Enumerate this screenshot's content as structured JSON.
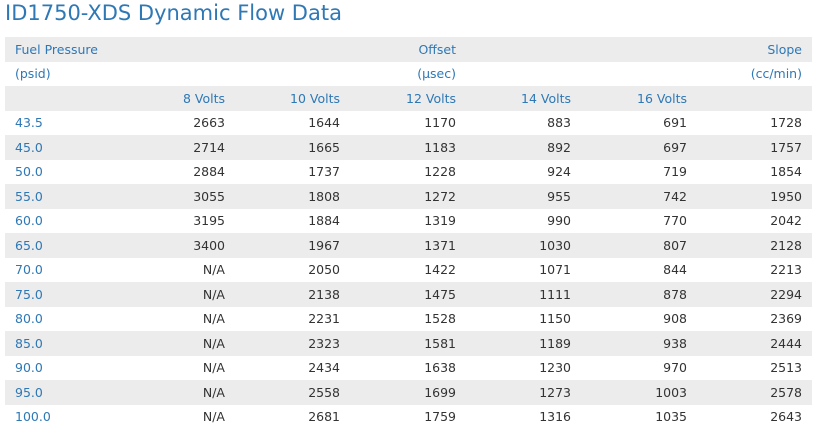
{
  "page": {
    "title": "ID1750-XDS Dynamic Flow Data"
  },
  "table": {
    "header_row1": {
      "c0": "Fuel Pressure",
      "c3": "Offset",
      "c6": "Slope"
    },
    "header_row2": {
      "c0": "(psid)",
      "c3": "(µsec)",
      "c6": "(cc/min)"
    },
    "header_row3": {
      "c1": "8 Volts",
      "c2": "10 Volts",
      "c3": "12 Volts",
      "c4": "14 Volts",
      "c5": "16 Volts"
    },
    "rows": [
      [
        "43.5",
        "2663",
        "1644",
        "1170",
        "883",
        "691",
        "1728"
      ],
      [
        "45.0",
        "2714",
        "1665",
        "1183",
        "892",
        "697",
        "1757"
      ],
      [
        "50.0",
        "2884",
        "1737",
        "1228",
        "924",
        "719",
        "1854"
      ],
      [
        "55.0",
        "3055",
        "1808",
        "1272",
        "955",
        "742",
        "1950"
      ],
      [
        "60.0",
        "3195",
        "1884",
        "1319",
        "990",
        "770",
        "2042"
      ],
      [
        "65.0",
        "3400",
        "1967",
        "1371",
        "1030",
        "807",
        "2128"
      ],
      [
        "70.0",
        "N/A",
        "2050",
        "1422",
        "1071",
        "844",
        "2213"
      ],
      [
        "75.0",
        "N/A",
        "2138",
        "1475",
        "1111",
        "878",
        "2294"
      ],
      [
        "80.0",
        "N/A",
        "2231",
        "1528",
        "1150",
        "908",
        "2369"
      ],
      [
        "85.0",
        "N/A",
        "2323",
        "1581",
        "1189",
        "938",
        "2444"
      ],
      [
        "90.0",
        "N/A",
        "2434",
        "1638",
        "1230",
        "970",
        "2513"
      ],
      [
        "95.0",
        "N/A",
        "2558",
        "1699",
        "1273",
        "1003",
        "2578"
      ],
      [
        "100.0",
        "N/A",
        "2681",
        "1759",
        "1316",
        "1035",
        "2643"
      ]
    ]
  }
}
